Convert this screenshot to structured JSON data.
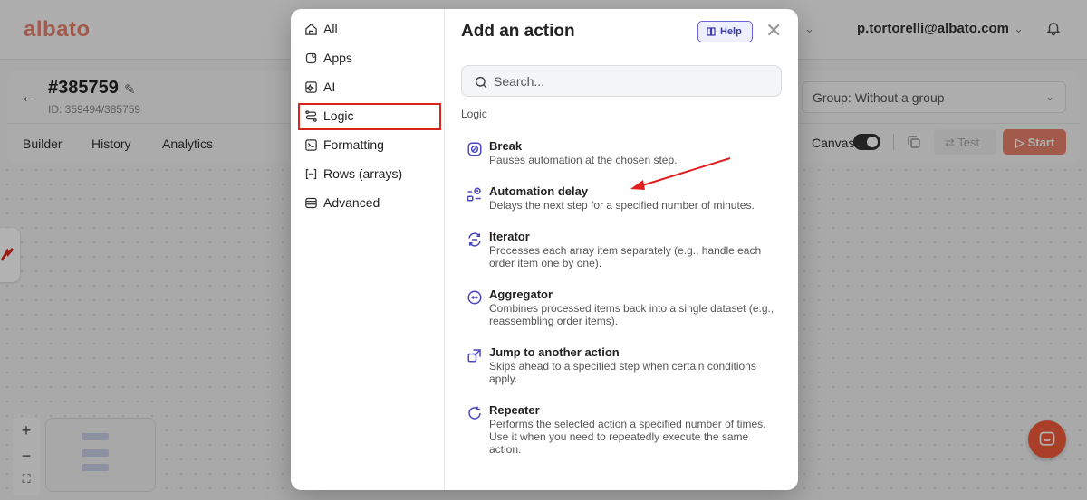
{
  "app": {
    "logo": "albato",
    "user_email": "p.tortorelli@albato.com"
  },
  "automation": {
    "title": "#385759",
    "id_label": "ID: 359494/385759",
    "tabs": [
      "Builder",
      "History",
      "Analytics"
    ]
  },
  "toolbar": {
    "group_select": "Group: Without a group",
    "canvas_label": "Canvas",
    "canvas_on": true,
    "test_label": "Test",
    "start_label": "Start"
  },
  "zoom": {
    "plus": "+",
    "minus": "−"
  },
  "modal": {
    "title": "Add an action",
    "help_label": "Help",
    "search_placeholder": "Search...",
    "section_label": "Logic",
    "categories": [
      {
        "label": "All",
        "icon": "home-icon"
      },
      {
        "label": "Apps",
        "icon": "apps-icon"
      },
      {
        "label": "AI",
        "icon": "ai-sparkle-icon"
      },
      {
        "label": "Logic",
        "icon": "logic-branch-icon",
        "selected": true
      },
      {
        "label": "Formatting",
        "icon": "formatting-icon"
      },
      {
        "label": "Rows (arrays)",
        "icon": "array-brackets-icon"
      },
      {
        "label": "Advanced",
        "icon": "advanced-icon"
      }
    ],
    "actions": [
      {
        "name": "Break",
        "desc": "Pauses automation at the chosen step.",
        "icon": "break-icon"
      },
      {
        "name": "Automation delay",
        "desc": "Delays the next step for a specified number of minutes.",
        "icon": "delay-icon"
      },
      {
        "name": "Iterator",
        "desc": "Processes each array item separately (e.g., handle each order item one by one).",
        "icon": "iterator-icon"
      },
      {
        "name": "Aggregator",
        "desc": "Combines processed items back into a single dataset (e.g., reassembling order items).",
        "icon": "aggregator-icon"
      },
      {
        "name": "Jump to another action",
        "desc": "Skips ahead to a specified step when certain conditions apply.",
        "icon": "jump-icon"
      },
      {
        "name": "Repeater",
        "desc": "Performs the selected action a specified number of times. Use it when you need to repeatedly execute the same action.",
        "icon": "repeater-icon"
      }
    ]
  },
  "colors": {
    "brand": "#e8826b",
    "accent": "#3e3aa5",
    "highlight": "#d9261c",
    "chat": "#f25b3b"
  }
}
